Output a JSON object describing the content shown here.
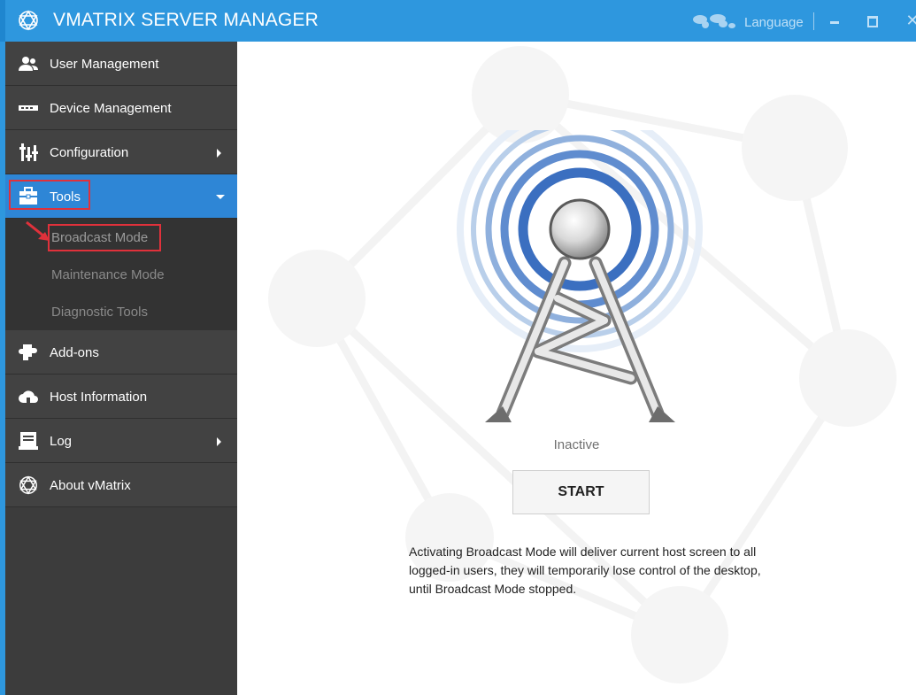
{
  "window": {
    "title": "VMATRIX SERVER MANAGER",
    "language_label": "Language",
    "close_glyph": "✕"
  },
  "colors": {
    "titlebar": "#2e97de",
    "sidebar": "#424242",
    "active": "#2e86d6",
    "highlight": "#e0313b"
  },
  "sidebar": {
    "items": [
      {
        "label": "User Management",
        "icon": "users-icon"
      },
      {
        "label": "Device Management",
        "icon": "device-icon"
      },
      {
        "label": "Configuration",
        "icon": "sliders-icon"
      },
      {
        "label": "Tools",
        "icon": "toolbox-icon"
      },
      {
        "label": "Add-ons",
        "icon": "puzzle-icon"
      },
      {
        "label": "Host Information",
        "icon": "cloud-icon"
      },
      {
        "label": "Log",
        "icon": "log-icon"
      },
      {
        "label": "About vMatrix",
        "icon": "vmatrix-logo-icon"
      }
    ],
    "tools_subitems": [
      {
        "label": "Broadcast Mode"
      },
      {
        "label": "Maintenance Mode"
      },
      {
        "label": "Diagnostic Tools"
      }
    ]
  },
  "main": {
    "status": "Inactive",
    "start_label": "START",
    "description": "Activating Broadcast Mode will deliver current host screen to all logged-in users, they will temporarily lose control of the desktop, until Broadcast Mode stopped."
  }
}
